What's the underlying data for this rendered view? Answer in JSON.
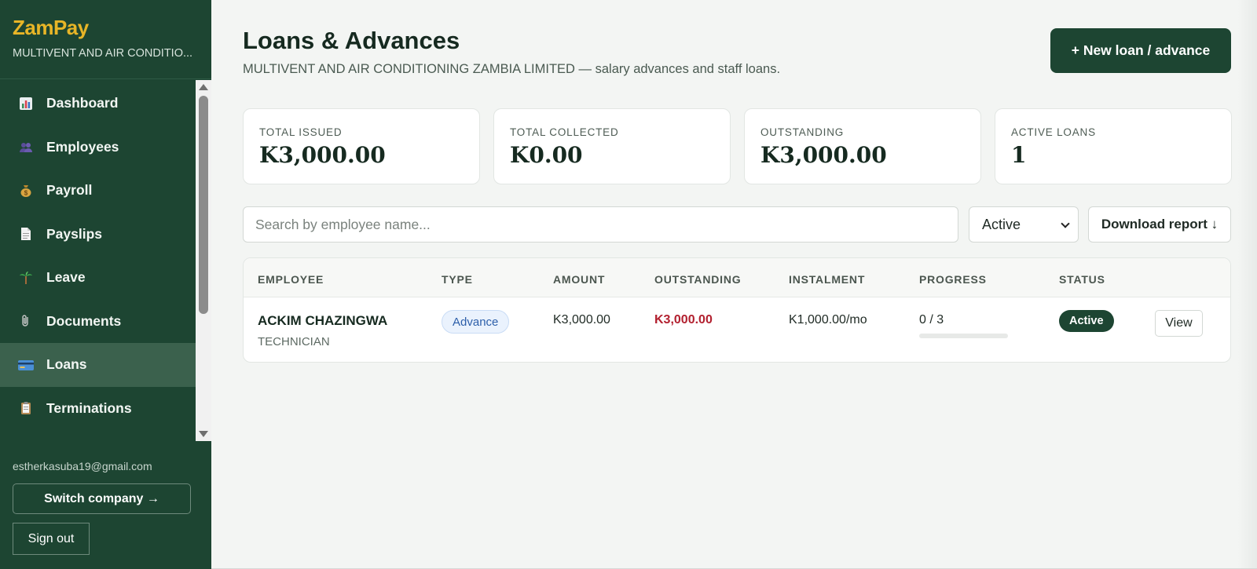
{
  "sidebar": {
    "brand": "ZamPay",
    "company": "MULTIVENT AND AIR CONDITIO...",
    "items": [
      {
        "label": "Dashboard",
        "icon": "chart-icon"
      },
      {
        "label": "Employees",
        "icon": "people-icon"
      },
      {
        "label": "Payroll",
        "icon": "money-bag-icon"
      },
      {
        "label": "Payslips",
        "icon": "document-icon"
      },
      {
        "label": "Leave",
        "icon": "palm-tree-icon"
      },
      {
        "label": "Documents",
        "icon": "paperclip-icon"
      },
      {
        "label": "Loans",
        "icon": "credit-card-icon",
        "active": true
      },
      {
        "label": "Terminations",
        "icon": "clipboard-icon"
      }
    ],
    "user_email": "estherkasuba19@gmail.com",
    "switch_company": "Switch company →",
    "sign_out": "Sign out"
  },
  "header": {
    "title": "Loans & Advances",
    "subtitle": "MULTIVENT AND AIR CONDITIONING ZAMBIA LIMITED — salary advances and staff loans.",
    "new_button": "+ New loan / advance"
  },
  "stats": [
    {
      "label": "TOTAL ISSUED",
      "value": "K3,000.00"
    },
    {
      "label": "TOTAL COLLECTED",
      "value": "K0.00"
    },
    {
      "label": "OUTSTANDING",
      "value": "K3,000.00"
    },
    {
      "label": "ACTIVE LOANS",
      "value": "1"
    }
  ],
  "filters": {
    "search_placeholder": "Search by employee name...",
    "status_selected": "Active",
    "download_label": "Download report ↓"
  },
  "table": {
    "columns": [
      "EMPLOYEE",
      "TYPE",
      "AMOUNT",
      "OUTSTANDING",
      "INSTALMENT",
      "PROGRESS",
      "STATUS"
    ],
    "rows": [
      {
        "name": "ACKIM CHAZINGWA",
        "role": "TECHNICIAN",
        "type": "Advance",
        "amount": "K3,000.00",
        "outstanding": "K3,000.00",
        "instalment": "K1,000.00/mo",
        "progress_text": "0 / 3",
        "progress_fraction": 0,
        "status": "Active",
        "action": "View"
      }
    ]
  },
  "colors": {
    "sidebar_bg": "#1d4532",
    "brand_gold": "#e8b527",
    "accent_green": "#1d4532",
    "outstanding_red": "#b2202f",
    "badge_blue": "#2d5faa"
  }
}
